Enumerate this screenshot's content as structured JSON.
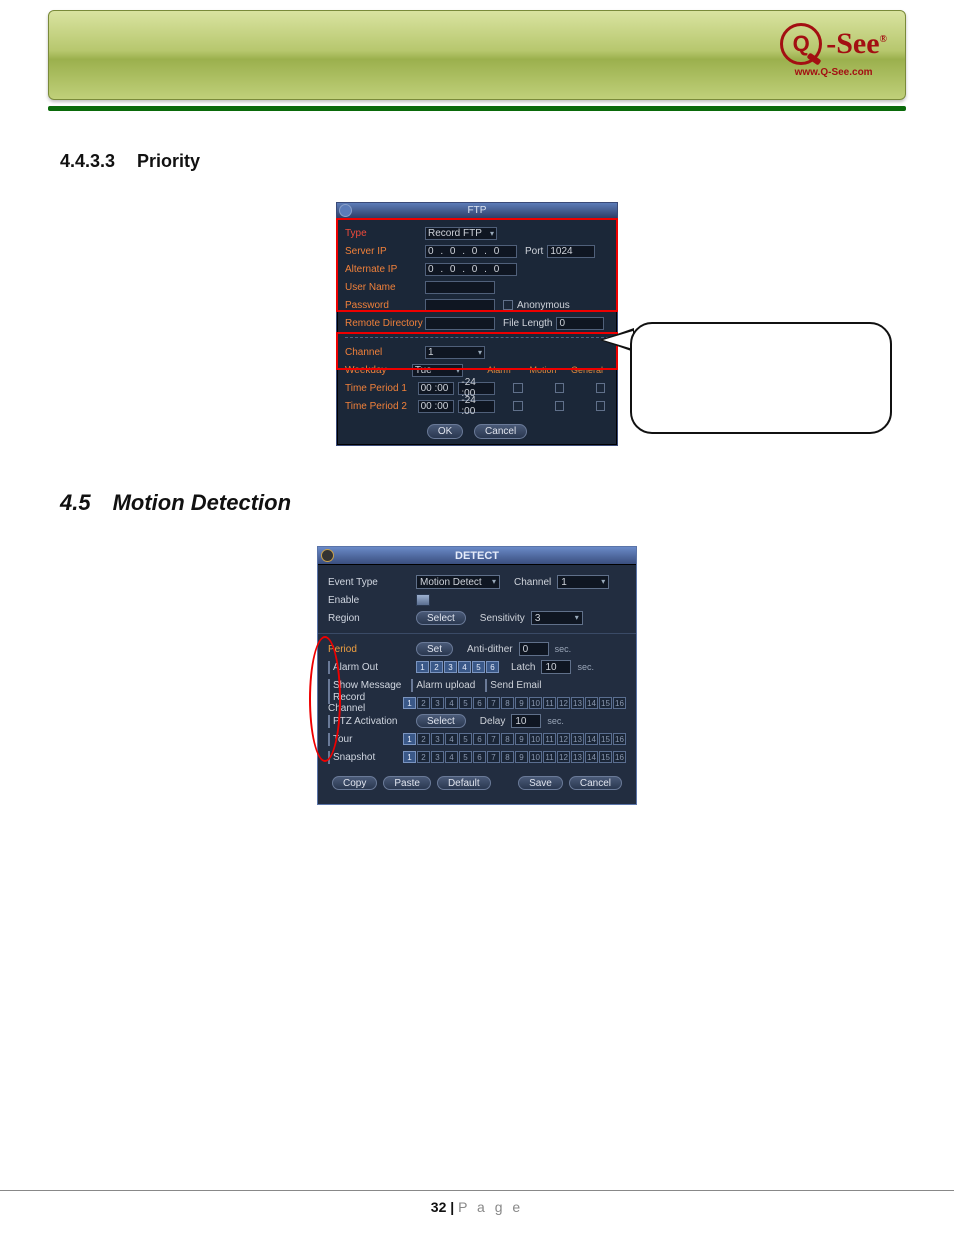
{
  "header": {
    "logo_dash": "-",
    "logo_text": "See",
    "logo_url": "www.Q-See.com"
  },
  "sections": {
    "priority": {
      "number": "4.4.3.3",
      "title": "Priority"
    },
    "motion": {
      "number": "4.5",
      "title": "Motion Detection"
    }
  },
  "ftp": {
    "title": "FTP",
    "type_label": "Type",
    "type_value": "Record FTP",
    "server_ip_label": "Server IP",
    "server_ip": "0   .   0   .   0   .   0",
    "port_label": "Port",
    "port_value": "1024",
    "alternate_ip_label": "Alternate IP",
    "alternate_ip": "0   .   0   .   0   .   0",
    "user_name_label": "User Name",
    "password_label": "Password",
    "anonymous_label": "Anonymous",
    "remote_dir_label": "Remote Directory",
    "file_length_label": "File Length",
    "file_length_value": "0",
    "channel_label": "Channel",
    "channel_value": "1",
    "weekday_label": "Weekday",
    "weekday_value": "Tue",
    "col_alarm": "Alarm",
    "col_motion": "Motion",
    "col_general": "General",
    "tp1_label": "Time Period 1",
    "tp1_from": "00 :00",
    "tp1_to": "-24 :00",
    "tp2_label": "Time Period 2",
    "tp2_from": "00 :00",
    "tp2_to": "-24 :00",
    "ok": "OK",
    "cancel": "Cancel"
  },
  "detect": {
    "title": "DETECT",
    "event_type_label": "Event Type",
    "event_type_value": "Motion Detect",
    "channel_label": "Channel",
    "channel_value": "1",
    "enable_label": "Enable",
    "region_label": "Region",
    "select_btn": "Select",
    "sensitivity_label": "Sensitivity",
    "sensitivity_value": "3",
    "period_label": "Period",
    "set_btn": "Set",
    "antidither_label": "Anti-dither",
    "antidither_value": "0",
    "sec": "sec.",
    "alarm_out_label": "Alarm Out",
    "latch_label": "Latch",
    "latch_value": "10",
    "show_msg_label": "Show Message",
    "alarm_upload_label": "Alarm upload",
    "send_email_label": "Send Email",
    "record_channel_label": "Record Channel",
    "ptz_label": "PTZ Activation",
    "delay_label": "Delay",
    "delay_value": "10",
    "tour_label": "Tour",
    "snapshot_label": "Snapshot",
    "btn_copy": "Copy",
    "btn_paste": "Paste",
    "btn_default": "Default",
    "btn_save": "Save",
    "btn_cancel": "Cancel",
    "alarm_out_chips": [
      "1",
      "2",
      "3",
      "4",
      "5",
      "6"
    ],
    "chips16": [
      "1",
      "2",
      "3",
      "4",
      "5",
      "6",
      "7",
      "8",
      "9",
      "10",
      "11",
      "12",
      "13",
      "14",
      "15",
      "16"
    ]
  },
  "footer": {
    "page_num": "32 |",
    "page_word": "P a g e"
  }
}
